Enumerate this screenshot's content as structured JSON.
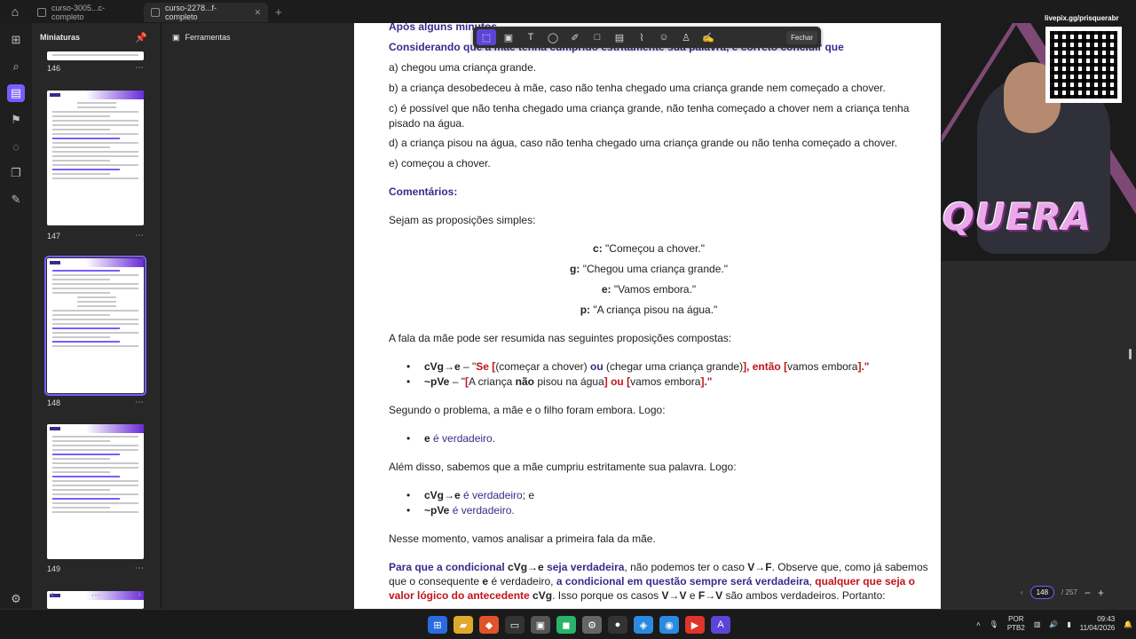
{
  "tabs": [
    {
      "label": "curso-3005...c-completo"
    },
    {
      "label": "curso-2278...f-completo"
    }
  ],
  "left_rail": {
    "icons": [
      "grid-icon",
      "search-icon",
      "thumbnails-icon",
      "bookmark-icon",
      "comments-icon",
      "layers-icon",
      "attachment-icon",
      "settings-icon"
    ]
  },
  "thumbnails": {
    "title": "Miniaturas",
    "pages": [
      {
        "number": "146"
      },
      {
        "number": "147"
      },
      {
        "number": "148"
      },
      {
        "number": "149"
      }
    ],
    "more": "⋯"
  },
  "tools_panel": {
    "title": "Ferramentas"
  },
  "annotation_toolbar": {
    "tools": [
      "select-tool",
      "text-box-tool",
      "text-tool",
      "comment-tool",
      "highlight-tool",
      "shape-tool",
      "ink-tool",
      "attach-tool",
      "sticker-tool",
      "stamp-tool",
      "signature-tool"
    ],
    "close_label": "Fechar"
  },
  "document": {
    "top_partial": "Após alguns minutos,",
    "question": "Considerando que a mãe tenha cumprido estritamente sua palavra, é correto concluir que",
    "options": [
      "a) chegou uma criança grande.",
      "b) a criança desobedeceu à mãe, caso não tenha chegado uma criança grande nem começado a chover.",
      "c) é possível que não tenha chegado uma criança grande, não tenha começado a chover nem a criança tenha",
      "pisado na água.",
      "d) a criança pisou na água, caso não tenha chegado uma criança grande ou não tenha começado a chover.",
      "e) começou a chover."
    ],
    "comments_heading": "Comentários:",
    "intro": "Sejam as proposições simples:",
    "props": [
      {
        "var": "c:",
        "text": "\"Começou a chover.\""
      },
      {
        "var": "g:",
        "text": "\"Chegou uma criança grande.\""
      },
      {
        "var": "e:",
        "text": "\"Vamos embora.\""
      },
      {
        "var": "p:",
        "text": "\"A criança pisou na água.\""
      }
    ],
    "compound_intro": "A fala da mãe pode ser resumida nas seguintes proposições compostas:",
    "compound1": {
      "formula": "cVg→e",
      "dash": " – \"",
      "se": "Se [",
      "p1": "(começar a chover) ",
      "ou": "ou ",
      "p2": "(chegar uma criança grande)",
      "entao": "], então [",
      "p3": "vamos embora",
      "end": "].\""
    },
    "compound2": {
      "formula": "~pVe",
      "dash": " – \"",
      "b1": "[",
      "p1": "A criança ",
      "nao": "não",
      "p2": " pisou na água",
      "ou": "] ou [",
      "p3": "vamos embora",
      "end": "].\""
    },
    "problem_line": "Segundo o problema, a mãe e o filho foram embora. Logo:",
    "e_true": {
      "var": "e",
      "text": " é verdadeiro."
    },
    "also_line": "Além disso, sabemos que a mãe cumpriu estritamente sua palavra. Logo:",
    "true1": {
      "var": "cVg→e",
      "text": " é verdadeiro",
      "tail": "; e"
    },
    "true2": {
      "var": "~pVe",
      "text": " é verdadeiro."
    },
    "moment_line": "Nesse momento, vamos analisar a primeira fala da mãe.",
    "final1": {
      "a": "Para que a condicional ",
      "b": "cVg→e",
      "c": " seja verdadeira",
      "d": ", não podemos ter o caso ",
      "e": "V→F",
      "f": ". Observe que, como já sabemos"
    },
    "final2": {
      "a": "que o consequente ",
      "b": "e",
      "c": " é verdadeiro, ",
      "d": "a condicional em questão sempre será verdadeira",
      "e": ", ",
      "f": "qualquer que seja o"
    },
    "final3": {
      "a": "valor lógico do antecedente ",
      "b": "cVg",
      "c": ". Isso porque os casos ",
      "d": "V→V",
      "e": " e ",
      "f": "F→V",
      "g": " são ambos verdadeiros. Portanto:"
    }
  },
  "overlay": {
    "live_link": "livepix.gg/prisquerabr",
    "logo": "PRISQUERA"
  },
  "page_nav": {
    "current": "148",
    "total": "257"
  },
  "taskbar": {
    "language": "POR",
    "layout": "PTB2",
    "time": "09:43",
    "date": "11/04/2026"
  },
  "colors": {
    "accent": "#7a5cff",
    "doc_purple": "#3b2a8a",
    "doc_red": "#c0141b"
  }
}
